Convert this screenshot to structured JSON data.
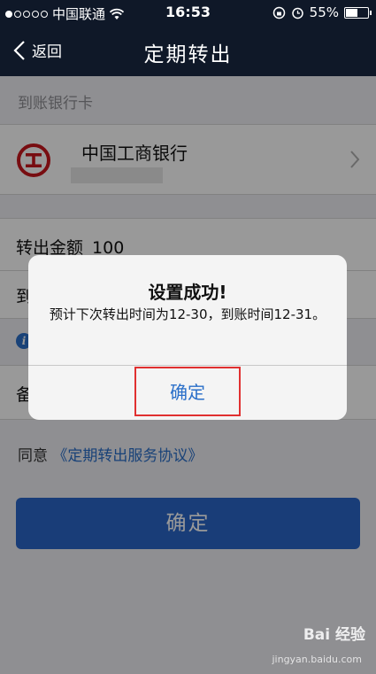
{
  "status_bar": {
    "carrier": "中国联通",
    "time": "16:53",
    "battery": "55%",
    "battery_fraction": 0.55
  },
  "nav": {
    "back_label": "返回",
    "title": "定期转出"
  },
  "form": {
    "section_label": "到账银行卡",
    "bank_name": "中国工商银行",
    "amount_label": "转出金额",
    "amount_value": "100",
    "arrive_label_partial": "到",
    "memo_label_partial": "备",
    "agree_prefix": "同意",
    "agreement_link": "《定期转出服务协议》",
    "confirm_label": "确定"
  },
  "alert": {
    "title": "设置成功!",
    "message": "预计下次转出时间为12-30，到账时间12-31。",
    "button_label": "确定"
  },
  "watermark": {
    "brand": "Bai  经验",
    "url": "jingyan.baidu.com"
  },
  "colors": {
    "nav_bg": "#0f1828",
    "accent": "#2a6fc9",
    "primary_button": "#2b66c8",
    "highlight_border": "#e03030",
    "bank_logo": "#c8161d"
  }
}
